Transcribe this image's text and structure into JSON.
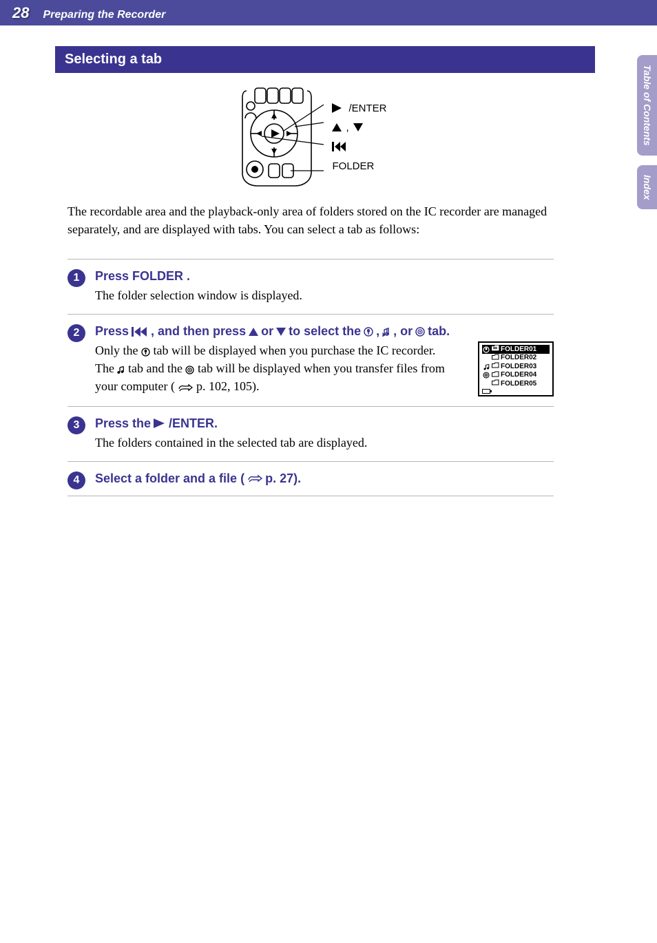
{
  "header": {
    "page_number": "28",
    "breadcrumb": "Preparing the Recorder"
  },
  "side_tabs": {
    "toc": "Table of Contents",
    "index": "Index"
  },
  "section_heading": "Selecting a tab",
  "diagram_labels": {
    "enter": "/ENTER",
    "updown": ",",
    "prev": "",
    "folder": "FOLDER"
  },
  "intro": "The recordable area and the playback-only area of folders stored on the IC recorder are managed separately, and are displayed with tabs. You can select a tab as follows:",
  "steps": [
    {
      "num": "1",
      "title_parts": [
        "Press FOLDER ."
      ],
      "body": "The folder selection window is displayed."
    },
    {
      "num": "2",
      "title_prefix": "Press ",
      "title_mid1": " , and then press ",
      "title_mid2": " or ",
      "title_mid3": "  to select the ",
      "title_sep": ", ",
      "title_sep2": ", or ",
      "title_suffix": " tab.",
      "body_a": "Only the ",
      "body_b": " tab will be displayed when you purchase the IC recorder.",
      "body_c": "The ",
      "body_d": " tab and the ",
      "body_e": " tab will be displayed when you transfer files from your computer (",
      "body_f": "  p. 102, 105)."
    },
    {
      "num": "3",
      "title_prefix": "Press the ",
      "title_suffix": " /ENTER.",
      "body": "The folders contained in the selected tab are displayed."
    },
    {
      "num": "4",
      "title_prefix": "Select a folder and a file (",
      "title_suffix": " p. 27)."
    }
  ],
  "lcd": {
    "rows": [
      {
        "tab": "voice",
        "name": "FOLDER01",
        "selected": true
      },
      {
        "tab": "",
        "name": "FOLDER02",
        "selected": false
      },
      {
        "tab": "music",
        "name": "FOLDER03",
        "selected": false
      },
      {
        "tab": "podcast",
        "name": "FOLDER04",
        "selected": false
      },
      {
        "tab": "",
        "name": "FOLDER05",
        "selected": false
      }
    ]
  }
}
